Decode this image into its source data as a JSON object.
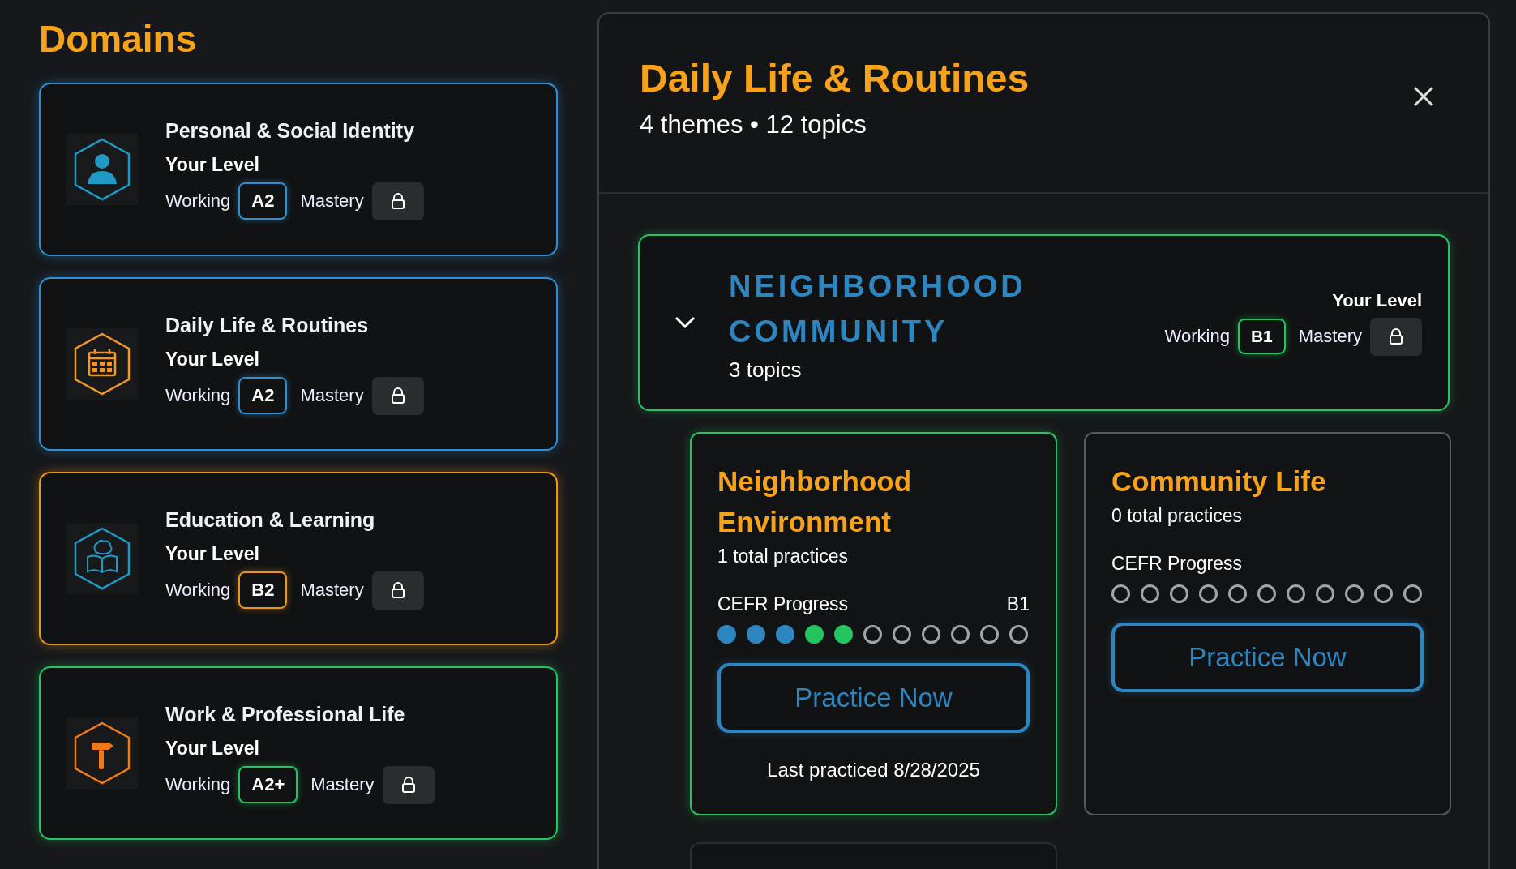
{
  "sidebar": {
    "title": "Domains",
    "domains": [
      {
        "title": "Personal & Social Identity",
        "kind": "person",
        "color": "#2f8fd0",
        "level_label": "Your Level",
        "working_label": "Working",
        "working_level": "A2",
        "mastery_label": "Mastery",
        "mastery_locked": true
      },
      {
        "title": "Daily Life & Routines",
        "kind": "calendar",
        "color": "#2f8fd0",
        "level_label": "Your Level",
        "working_label": "Working",
        "working_level": "A2",
        "mastery_label": "Mastery",
        "mastery_locked": true
      },
      {
        "title": "Education & Learning",
        "kind": "brain-book",
        "color": "#e8961c",
        "level_label": "Your Level",
        "working_label": "Working",
        "working_level": "B2",
        "mastery_label": "Mastery",
        "mastery_locked": true
      },
      {
        "title": "Work & Professional Life",
        "kind": "hammer",
        "color": "#22c55e",
        "level_label": "Your Level",
        "working_label": "Working",
        "working_level": "A2+",
        "mastery_label": "Mastery",
        "mastery_locked": true
      }
    ]
  },
  "detail": {
    "title": "Daily Life & Routines",
    "subtitle": "4 themes • 12 topics",
    "theme": {
      "title": "NEIGHBORHOOD COMMUNITY",
      "count": "3 topics",
      "expanded": true,
      "level_label": "Your Level",
      "working_label": "Working",
      "working_level": "B1",
      "mastery_label": "Mastery",
      "mastery_locked": true
    },
    "topics": [
      {
        "kind": "card",
        "highlighted": true,
        "title": "Neighborhood Environment",
        "practices": "1 total practices",
        "progress_label": "CEFR Progress",
        "progress_level": "B1",
        "dots": [
          {
            "filled": true,
            "color": "#2e86c1"
          },
          {
            "filled": true,
            "color": "#2e86c1"
          },
          {
            "filled": true,
            "color": "#2e86c1"
          },
          {
            "filled": true,
            "color": "#22c55e"
          },
          {
            "filled": true,
            "color": "#22c55e"
          },
          {
            "filled": false
          },
          {
            "filled": false
          },
          {
            "filled": false
          },
          {
            "filled": false
          },
          {
            "filled": false
          },
          {
            "filled": false
          }
        ],
        "button": "Practice Now",
        "last_practiced": "Last practiced 8/28/2025"
      },
      {
        "kind": "card",
        "highlighted": false,
        "title": "Community Life",
        "practices": "0 total practices",
        "progress_label": "CEFR Progress",
        "dots": [
          {
            "filled": false
          },
          {
            "filled": false
          },
          {
            "filled": false
          },
          {
            "filled": false
          },
          {
            "filled": false
          },
          {
            "filled": false
          },
          {
            "filled": false
          },
          {
            "filled": false
          },
          {
            "filled": false
          },
          {
            "filled": false
          },
          {
            "filled": false
          }
        ],
        "button": "Practice Now"
      },
      {
        "kind": "cut_off"
      }
    ]
  }
}
